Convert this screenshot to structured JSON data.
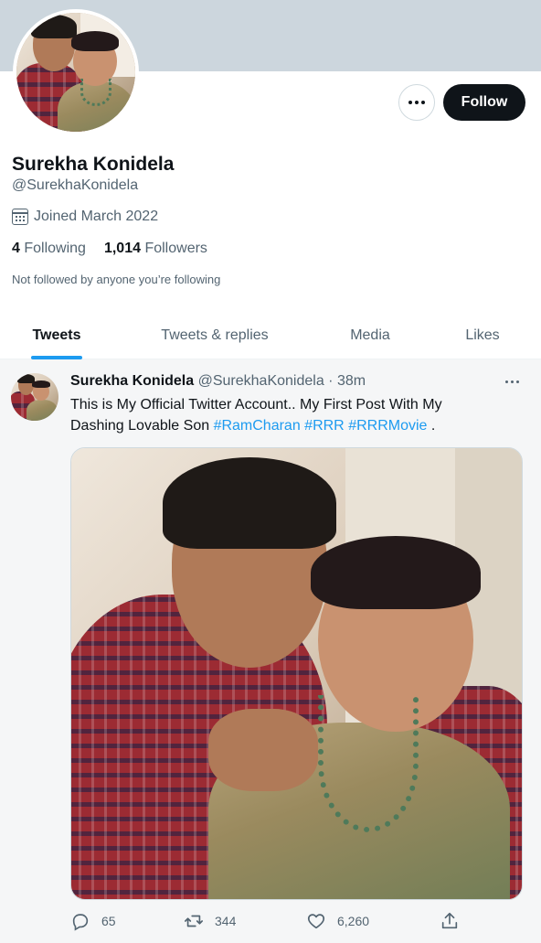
{
  "profile": {
    "name": "Surekha Konidela",
    "handle": "@SurekhaKonidela",
    "joined": "Joined March 2022",
    "following_count": "4",
    "following_label": "Following",
    "followers_count": "1,014",
    "followers_label": "Followers",
    "not_followed_text": "Not followed by anyone you’re following",
    "follow_label": "Follow"
  },
  "tabs": [
    {
      "label": "Tweets",
      "active": true
    },
    {
      "label": "Tweets & replies",
      "active": false
    },
    {
      "label": "Media",
      "active": false
    },
    {
      "label": "Likes",
      "active": false
    }
  ],
  "tweet": {
    "author_name": "Surekha Konidela",
    "author_handle": "@SurekhaKonidela",
    "separator": "·",
    "time": "38m",
    "text_line1": "This is My Official Twitter Account.. My First Post With My",
    "text_line2_prefix": "Dashing Lovable Son ",
    "hashtags": [
      "#RamCharan",
      "#RRR",
      "#RRRMovie"
    ],
    "text_suffix": " .",
    "replies": "65",
    "retweets": "344",
    "likes": "6,260"
  },
  "icons": {
    "more": "more-horizontal-icon",
    "calendar": "calendar-icon",
    "reply": "reply-icon",
    "retweet": "retweet-icon",
    "like": "heart-icon",
    "share": "share-icon"
  },
  "colors": {
    "accent": "#1d9bf0",
    "banner": "#ccd6dd",
    "text_primary": "#0f1419",
    "text_secondary": "#536471"
  }
}
